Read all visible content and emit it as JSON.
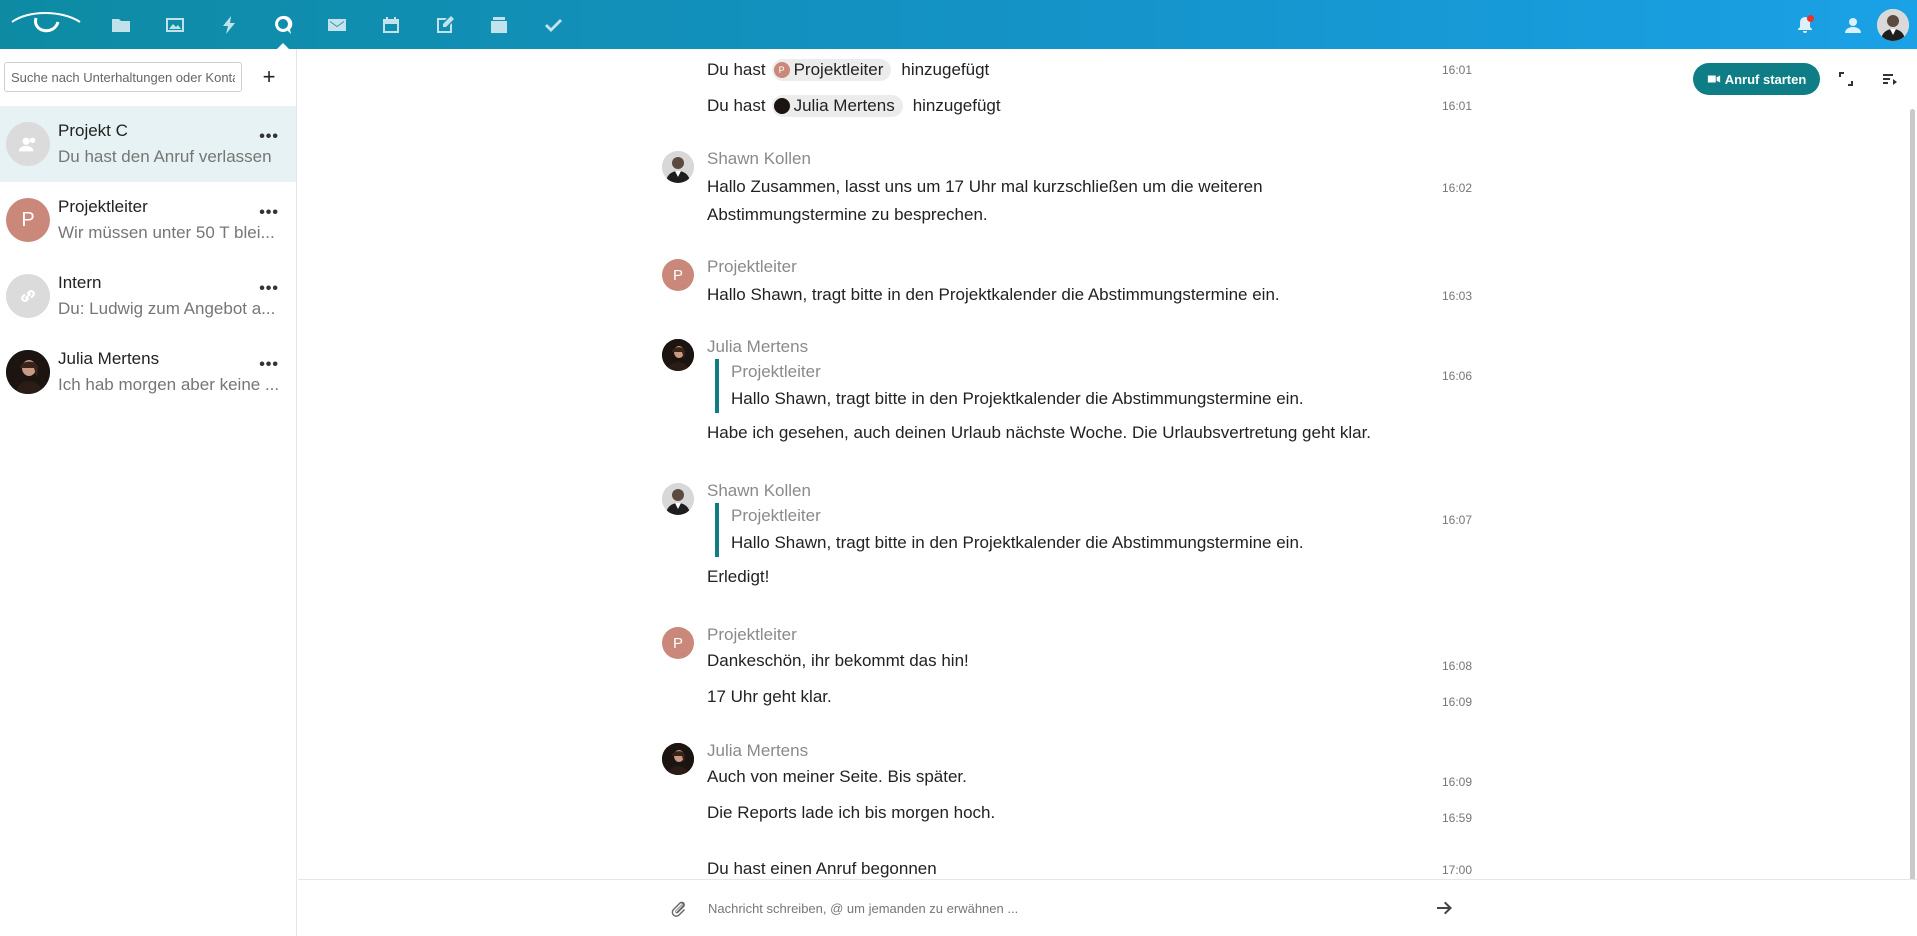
{
  "topbar": {
    "apps": [
      {
        "name": "files-icon"
      },
      {
        "name": "photos-icon"
      },
      {
        "name": "activity-icon"
      },
      {
        "name": "talk-icon",
        "active": true
      },
      {
        "name": "mail-icon"
      },
      {
        "name": "calendar-icon"
      },
      {
        "name": "notes-icon"
      },
      {
        "name": "deck-icon"
      },
      {
        "name": "tasks-icon"
      }
    ]
  },
  "sidebar": {
    "search_placeholder": "Suche nach Unterhaltungen oder Kontakten",
    "conversations": [
      {
        "name": "Projekt C",
        "last": "Du hast den Anruf verlassen",
        "avatar": "group",
        "active": true
      },
      {
        "name": "Projektleiter",
        "last": "Wir müssen unter 50 T blei...",
        "avatar": "letter",
        "letter": "P",
        "color": "#c98879"
      },
      {
        "name": "Intern",
        "last": "Du: Ludwig zum Angebot a...",
        "avatar": "link"
      },
      {
        "name": "Julia Mertens",
        "last": "Ich hab morgen aber keine ...",
        "avatar": "photo"
      }
    ]
  },
  "header": {
    "call_label": "Anruf starten"
  },
  "messages": {
    "sys1": {
      "prefix": "Du hast",
      "mention": "Projektleiter",
      "suffix": "hinzugefügt",
      "time": "16:01"
    },
    "sys2": {
      "prefix": "Du hast",
      "mention": "Julia Mertens",
      "suffix": "hinzugefügt",
      "time": "16:01"
    },
    "m1": {
      "author": "Shawn Kollen",
      "text": "Hallo Zusammen, lasst uns um 17 Uhr mal kurzschließen um die weiteren Abstimmungstermine zu besprechen.",
      "time": "16:02"
    },
    "m2": {
      "author": "Projektleiter",
      "text": "Hallo Shawn, tragt bitte in den Projektkalender die Abstimmungstermine ein.",
      "time": "16:03"
    },
    "m3": {
      "author": "Julia Mertens",
      "quote_author": "Projektleiter",
      "quote_text": "Hallo Shawn, tragt bitte in den Projektkalender die Abstimmungstermine ein.",
      "text": "Habe ich gesehen, auch deinen Urlaub nächste Woche. Die Urlaubsvertretung geht klar.",
      "time": "16:06"
    },
    "m4": {
      "author": "Shawn Kollen",
      "quote_author": "Projektleiter",
      "quote_text": "Hallo Shawn, tragt bitte in den Projektkalender die Abstimmungstermine ein.",
      "text": "Erledigt!",
      "time": "16:07"
    },
    "m5": {
      "author": "Projektleiter",
      "text": "Dankeschön, ihr bekommt das hin!",
      "time": "16:08",
      "text2": "17 Uhr geht klar.",
      "time2": "16:09"
    },
    "m6": {
      "author": "Julia Mertens",
      "text": "Auch von meiner Seite. Bis später.",
      "time": "16:09",
      "text2": "Die Reports lade ich bis morgen hoch.",
      "time2": "16:59"
    },
    "sys3": {
      "text": "Du hast einen Anruf begonnen",
      "time": "17:00"
    }
  },
  "composer": {
    "placeholder": "Nachricht schreiben, @ um jemanden zu erwähnen ..."
  },
  "colors": {
    "accent": "#0e7d86",
    "topbar_start": "#0e8ba3",
    "topbar_end": "#1aa1e6",
    "active_row": "#e6f2f3",
    "projektleiter": "#c98879"
  }
}
